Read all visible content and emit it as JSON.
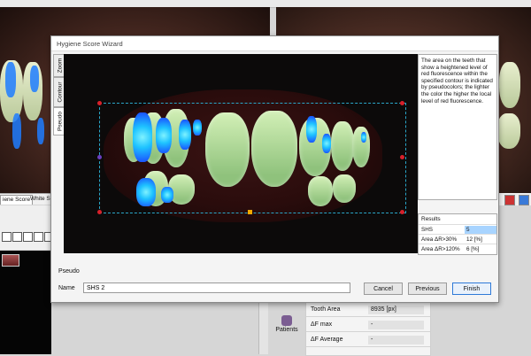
{
  "background": {
    "left_tabs": [
      "iene Score",
      "White Sp"
    ],
    "patients_label": "Patients",
    "info_rows": [
      {
        "label": "Tooth Area",
        "value": "8935 [px]"
      },
      {
        "label": "ΔF max",
        "value": "-"
      },
      {
        "label": "ΔF Average",
        "value": "-"
      }
    ]
  },
  "dialog": {
    "title": "Hygiene Score Wizard",
    "tabs": [
      "Zoom",
      "Contour",
      "Pseudo"
    ],
    "description": "The area on the teeth that show a heightened level of red fluorescence within the specified contour is indicated by pseudocolors; the lighter the color the higher the local level of red fluorescence.",
    "results": {
      "heading": "Results",
      "rows": [
        {
          "label": "SHS",
          "value": "5"
        },
        {
          "label": "Area ΔR>30%",
          "value": "12 [%]"
        },
        {
          "label": "Area ΔR>120%",
          "value": "6 [%]"
        }
      ]
    },
    "section_label": "Pseudo",
    "name_label": "Name",
    "name_value": "SHS 2",
    "buttons": {
      "cancel": "Cancel",
      "previous": "Previous",
      "finish": "Finish"
    }
  },
  "colors": {
    "stain_light": "#7ff2ff",
    "stain_dark": "#1a45ff",
    "roi_border": "#2aa7c9",
    "handle_red": "#d8202a",
    "handle_orange": "#f2a900",
    "highlight": "#a8d4ff"
  }
}
